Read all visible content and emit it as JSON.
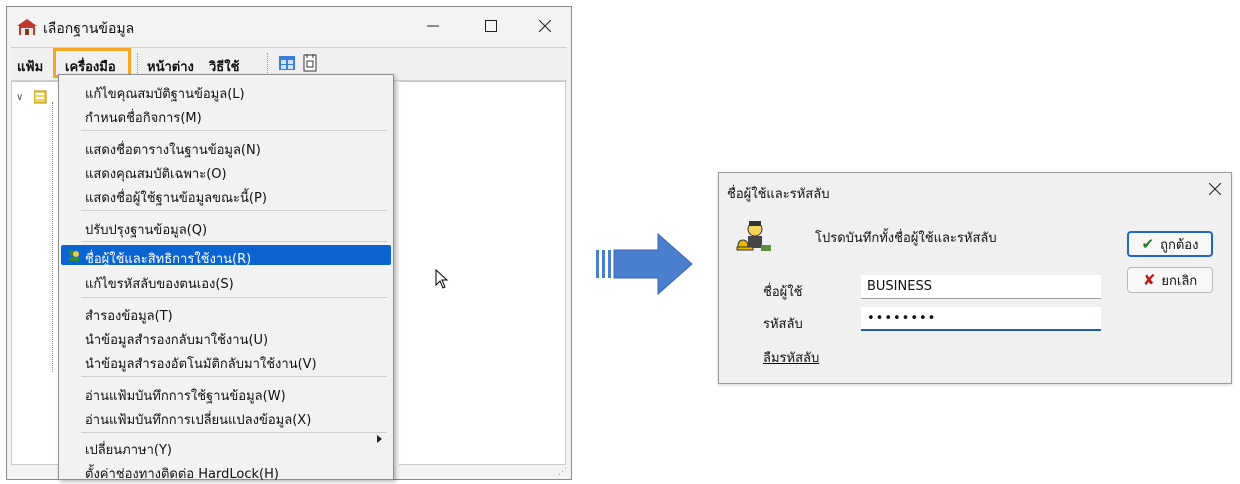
{
  "window": {
    "title": "เลือกฐานข้อมูล",
    "menu": {
      "file": "แฟ้ม",
      "tools": "เครื่องมือ",
      "window": "หน้าต่าง",
      "help": "วิธีใช้"
    },
    "dropdown": {
      "items": [
        "แก้ไขคุณสมบัติฐานข้อมูล(L)",
        "กำหนดชื่อกิจการ(M)",
        "แสดงชื่อตารางในฐานข้อมูล(N)",
        "แสดงคุณสมบัติเฉพาะ(O)",
        "แสดงชื่อผู้ใช้ฐานข้อมูลขณะนี้(P)",
        "ปรับปรุงฐานข้อมูล(Q)",
        "ชื่อผู้ใช้และสิทธิการใช้งาน(R)",
        "แก้ไขรหัสลับของตนเอง(S)",
        "สำรองข้อมูล(T)",
        "นำข้อมูลสำรองกลับมาใช้งาน(U)",
        "นำข้อมูลสำรองอัตโนมัติกลับมาใช้งาน(V)",
        "อ่านแฟ้มบันทึกการใช้ฐานข้อมูล(W)",
        "อ่านแฟ้มบันทึกการเปลี่ยนแปลงข้อมูล(X)",
        "เปลี่ยนภาษา(Y)",
        "ตั้งค่าช่องทางติดต่อ HardLock(H)"
      ]
    }
  },
  "dialog": {
    "title": "ชื่อผู้ใช้และรหัสลับ",
    "prompt": "โปรดบันทึกทั้งชื่อผู้ใช้และรหัสลับ",
    "username_label": "ชื่อผู้ใช้",
    "username_value": "BUSINESS",
    "password_label": "รหัสลับ",
    "password_value": "••••••••",
    "forgot_link": "ลืมรหัสลับ",
    "ok_label": "ถูกต้อง",
    "cancel_label": "ยกเลิก"
  },
  "colors": {
    "highlight": "#0a64d2",
    "menu_focus_border": "#f5a623",
    "arrow": "#4a7fd0"
  }
}
